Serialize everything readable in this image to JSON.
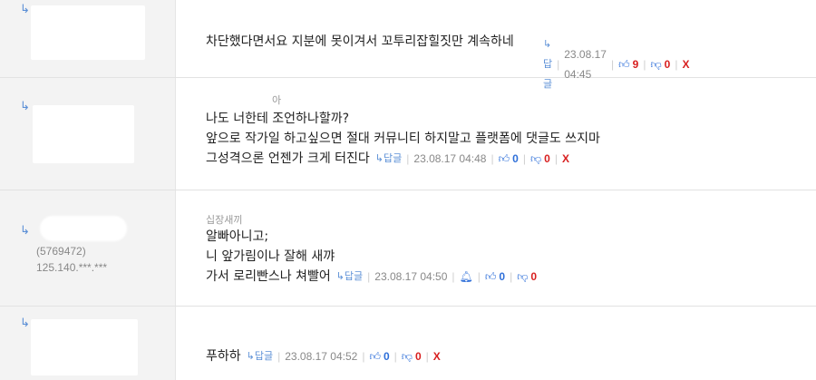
{
  "comments": [
    {
      "text_lines": [
        "차단했다면서요 지분에 못이겨서 꼬투리잡힐짓만 계속하네"
      ],
      "reply_label": "↳답글",
      "date": "23.08.17 04:45",
      "up": "9",
      "down": "0",
      "delete": "X"
    },
    {
      "nickname": "아",
      "text_lines": [
        "나도 너한테 조언하나할까?",
        "앞으로 작가일 하고싶으면 절대 커뮤니티 하지말고 플랫폼에 댓글도 쓰지마",
        "그성격으론 언젠가 크게 터진다"
      ],
      "reply_label": "↳답글",
      "date": "23.08.17 04:48",
      "up": "0",
      "down": "0",
      "delete": "X"
    },
    {
      "nickname": "십장새끼",
      "user_id": "(5769472)",
      "ip": "125.140.***.***",
      "text_lines": [
        "알빠아니고;",
        "니 앞가림이나 잘해 새꺄",
        "가서 로리빤스나 쳐빨어"
      ],
      "reply_label": "↳답글",
      "date": "23.08.17 04:50",
      "up": "0",
      "down": "0"
    },
    {
      "text_lines": [
        "푸하하"
      ],
      "reply_label": "↳답글",
      "date": "23.08.17 04:52",
      "up": "0",
      "down": "0",
      "delete": "X"
    }
  ]
}
